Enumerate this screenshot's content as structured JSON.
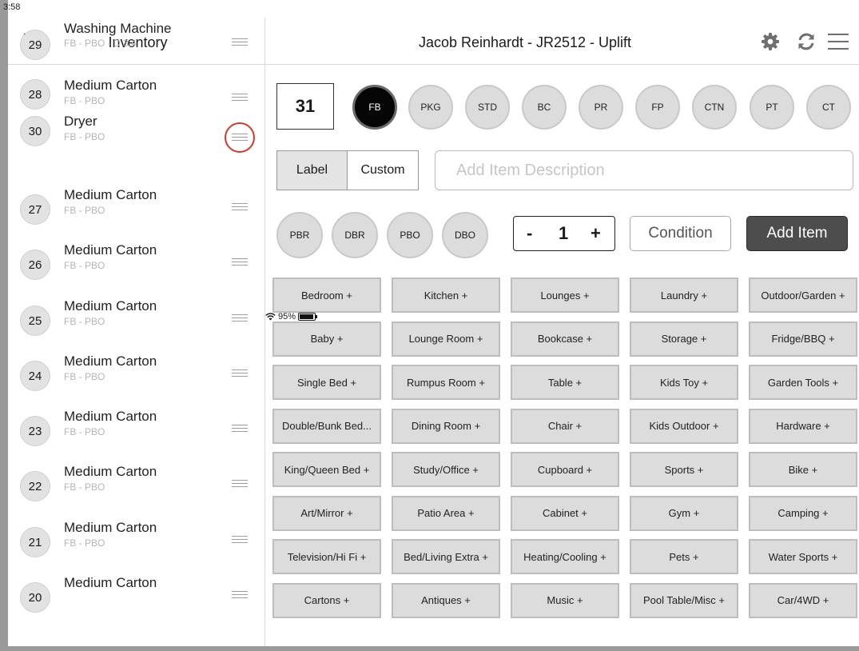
{
  "status": {
    "time": "3:58",
    "battery": "95%"
  },
  "left": {
    "title": "Inventory",
    "items": [
      {
        "num": "29",
        "name": "Washing Machine",
        "sub": "FB - PBO - D 3,4"
      },
      {
        "num": "28",
        "name": "Medium Carton",
        "sub": "FB - PBO"
      },
      {
        "num": "30",
        "name": "Dryer",
        "sub": "FB - PBO"
      },
      {
        "num": "27",
        "name": "Medium Carton",
        "sub": "FB - PBO"
      },
      {
        "num": "26",
        "name": "Medium Carton",
        "sub": "FB - PBO"
      },
      {
        "num": "25",
        "name": "Medium Carton",
        "sub": "FB - PBO"
      },
      {
        "num": "24",
        "name": "Medium Carton",
        "sub": "FB - PBO"
      },
      {
        "num": "23",
        "name": "Medium Carton",
        "sub": "FB - PBO"
      },
      {
        "num": "22",
        "name": "Medium Carton",
        "sub": "FB - PBO"
      },
      {
        "num": "21",
        "name": "Medium Carton",
        "sub": "FB - PBO"
      },
      {
        "num": "20",
        "name": "Medium Carton",
        "sub": ""
      }
    ]
  },
  "header": {
    "title": "Jacob Reinhardt - JR2512 - Uplift"
  },
  "form": {
    "item_number": "31",
    "categories": [
      "FB",
      "PKG",
      "STD",
      "BC",
      "PR",
      "FP",
      "CTN",
      "PT",
      "CT"
    ],
    "active_category": "FB",
    "label_tab": "Label",
    "custom_tab": "Custom",
    "description_placeholder": "Add Item Description",
    "conditions": [
      "PBR",
      "DBR",
      "PBO",
      "DBO"
    ],
    "stepper": {
      "minus": "-",
      "value": "1",
      "plus": "+"
    },
    "condition_button": "Condition",
    "add_button": "Add Item"
  },
  "rooms": [
    [
      "Bedroom +",
      "Kitchen +",
      "Lounges +",
      "Laundry +",
      "Outdoor/Garden +"
    ],
    [
      "Baby +",
      "Lounge Room +",
      "Bookcase +",
      "Storage +",
      "Fridge/BBQ +"
    ],
    [
      "Single Bed +",
      "Rumpus Room +",
      "Table +",
      "Kids Toy +",
      "Garden Tools +"
    ],
    [
      "Double/Bunk Bed...",
      "Dining Room +",
      "Chair +",
      "Kids Outdoor +",
      "Hardware +"
    ],
    [
      "King/Queen Bed +",
      "Study/Office +",
      "Cupboard +",
      "Sports +",
      "Bike +"
    ],
    [
      "Art/Mirror +",
      "Patio Area +",
      "Cabinet +",
      "Gym +",
      "Camping +"
    ],
    [
      "Television/Hi Fi +",
      "Bed/Living Extra +",
      "Heating/Cooling +",
      "Pets +",
      "Water Sports +"
    ],
    [
      "Cartons +",
      "Antiques +",
      "Music +",
      "Pool Table/Misc +",
      "Car/4WD +"
    ]
  ]
}
